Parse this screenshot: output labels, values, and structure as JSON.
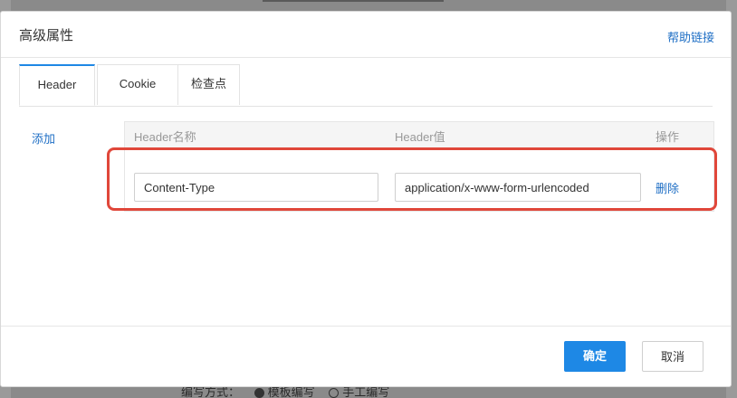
{
  "background": {
    "partial_text": "编写方式：",
    "radio_1": "模板编写",
    "radio_2": "手工编写"
  },
  "dialog": {
    "title": "高级属性",
    "help_link": "帮助链接"
  },
  "tabs": [
    {
      "label": "Header",
      "active": true
    },
    {
      "label": "Cookie",
      "active": false
    },
    {
      "label": "检查点",
      "active": false
    }
  ],
  "add_label": "添加",
  "table": {
    "headers": {
      "name": "Header名称",
      "value": "Header值",
      "op": "操作"
    },
    "rows": [
      {
        "name": "Content-Type",
        "value": "application/x-www-form-urlencoded",
        "action": "删除"
      }
    ]
  },
  "footer": {
    "ok_label": "确定",
    "cancel_label": "取消"
  },
  "colors": {
    "accent": "#1e88e5",
    "link": "#1f6fc5",
    "highlight": "#e0473a"
  }
}
